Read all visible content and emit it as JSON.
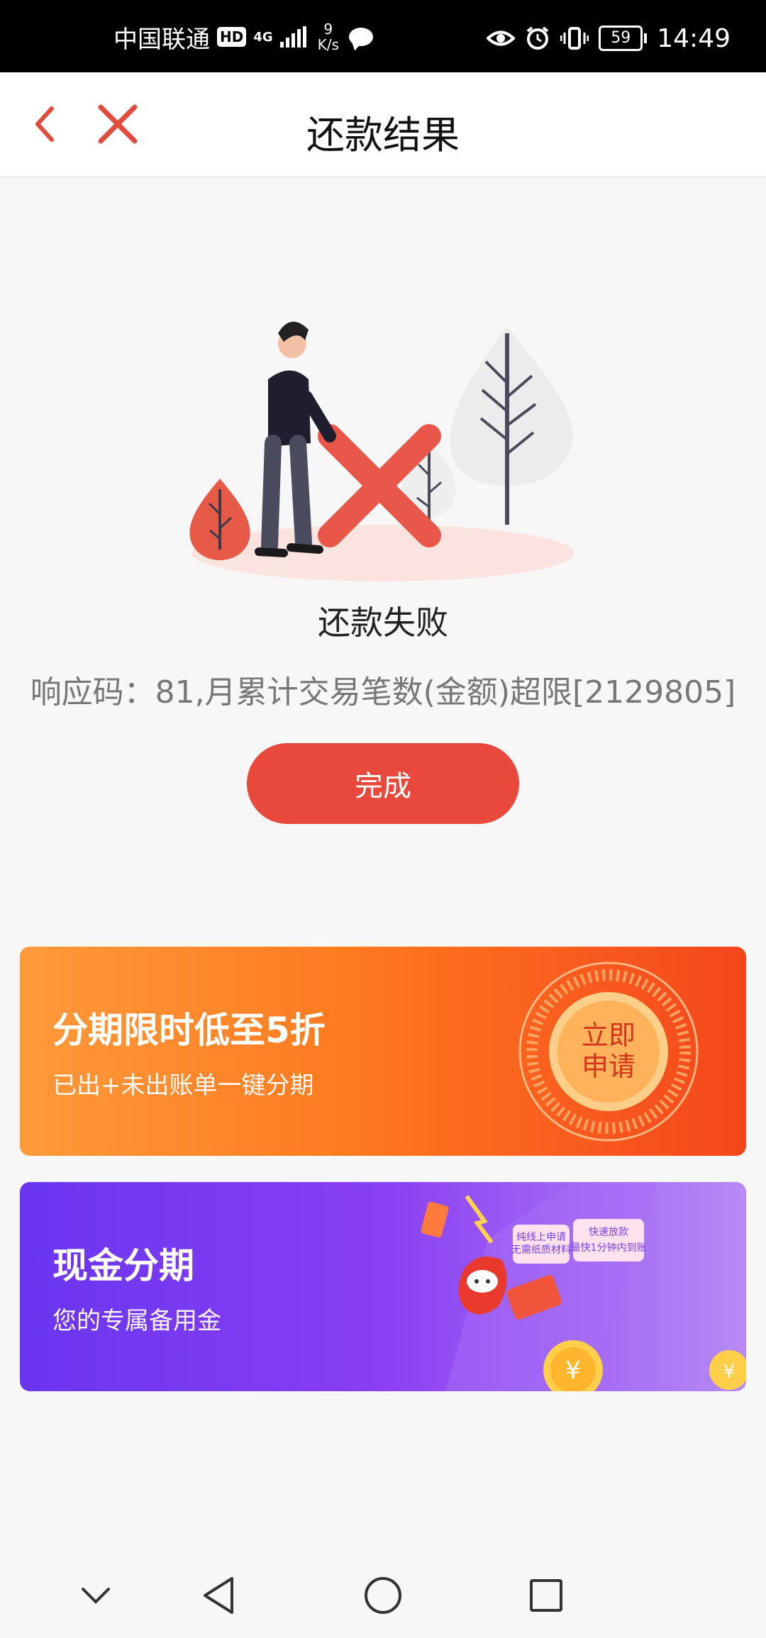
{
  "status_bar": {
    "carrier": "中国联通",
    "hd_badge": "HD",
    "network": "4G",
    "speed_value": "9",
    "speed_unit": "K/s",
    "battery": "59",
    "time": "14:49"
  },
  "nav": {
    "title": "还款结果"
  },
  "result": {
    "title": "还款失败",
    "message": "响应码：81,月累计交易笔数(金额)超限[2129805]",
    "done_label": "完成"
  },
  "banners": [
    {
      "title": "分期限时低至5折",
      "subtitle": "已出+未出账单一键分期",
      "badge_line1": "立即",
      "badge_line2": "申请"
    },
    {
      "title": "现金分期",
      "subtitle": "您的专属备用金",
      "card_text1": "纯线上申请",
      "card_text2": "无需纸质材料",
      "card_text3": "快速放款",
      "card_text4": "最快1分钟内到账"
    }
  ],
  "colors": {
    "accent": "#e9493c",
    "banner1_start": "#ff9a3a",
    "banner1_end": "#f4461c",
    "banner2_start": "#6a35f0",
    "banner2_end": "#b78af5"
  },
  "icons": {
    "back": "chevron-left-icon",
    "close": "close-icon",
    "nav_down": "chevron-down-icon",
    "nav_back": "triangle-back-icon",
    "nav_home": "circle-home-icon",
    "nav_recent": "square-recent-icon"
  }
}
